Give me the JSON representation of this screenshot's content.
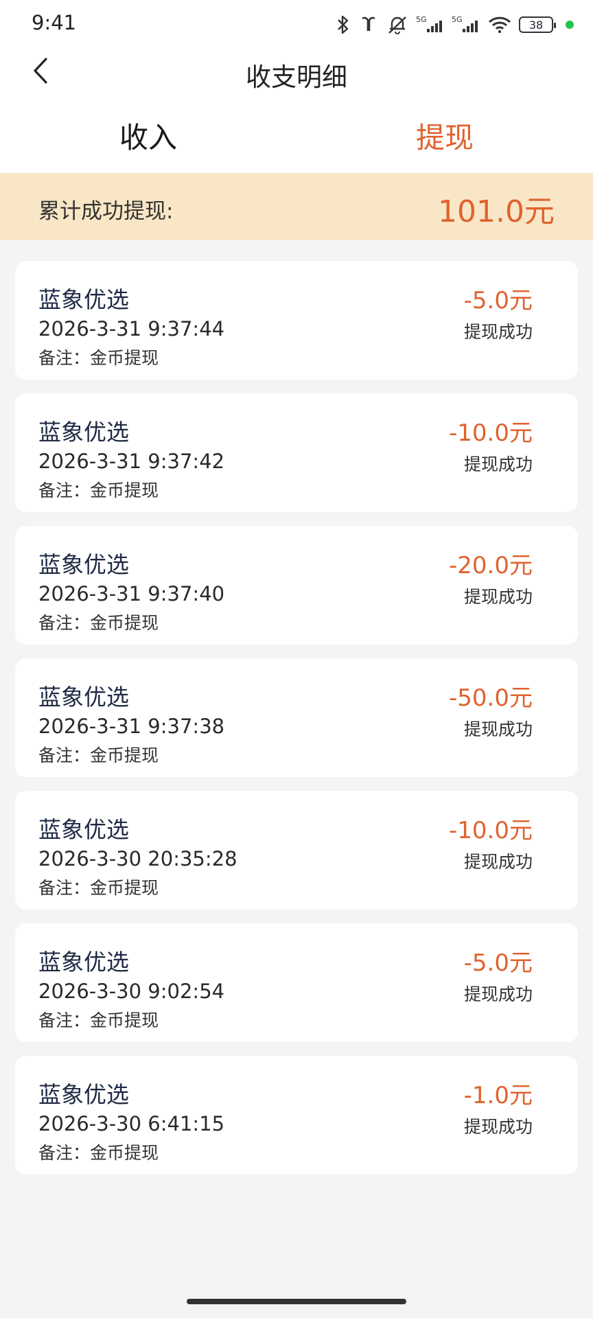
{
  "status_bar": {
    "time": "9:41",
    "battery": "38",
    "icons": [
      "bluetooth-icon",
      "earbuds-icon",
      "mute-bell-icon",
      "signal-5g-icon",
      "signal-5g-icon",
      "wifi-icon",
      "battery-icon",
      "green-dot-indicator"
    ]
  },
  "header": {
    "title": "收支明细",
    "back_icon": "chevron-left-icon"
  },
  "tabs": [
    {
      "label": "收入",
      "active": false
    },
    {
      "label": "提现",
      "active": true
    }
  ],
  "summary": {
    "label": "累计成功提现:",
    "value": "101.0元"
  },
  "records": [
    {
      "name": "蓝象优选",
      "time": "2026-3-31 9:37:44",
      "note": "备注：金币提现",
      "amount": "-5.0元",
      "status": "提现成功"
    },
    {
      "name": "蓝象优选",
      "time": "2026-3-31 9:37:42",
      "note": "备注：金币提现",
      "amount": "-10.0元",
      "status": "提现成功"
    },
    {
      "name": "蓝象优选",
      "time": "2026-3-31 9:37:40",
      "note": "备注：金币提现",
      "amount": "-20.0元",
      "status": "提现成功"
    },
    {
      "name": "蓝象优选",
      "time": "2026-3-31 9:37:38",
      "note": "备注：金币提现",
      "amount": "-50.0元",
      "status": "提现成功"
    },
    {
      "name": "蓝象优选",
      "time": "2026-3-30 20:35:28",
      "note": "备注：金币提现",
      "amount": "-10.0元",
      "status": "提现成功"
    },
    {
      "name": "蓝象优选",
      "time": "2026-3-30 9:02:54",
      "note": "备注：金币提现",
      "amount": "-5.0元",
      "status": "提现成功"
    },
    {
      "name": "蓝象优选",
      "time": "2026-3-30 6:41:15",
      "note": "备注：金币提现",
      "amount": "-1.0元",
      "status": "提现成功"
    }
  ],
  "colors": {
    "accent": "#e0622e",
    "summary_bg": "#f9e6c6",
    "page_bg": "#f4f4f4",
    "card_bg": "#ffffff"
  }
}
